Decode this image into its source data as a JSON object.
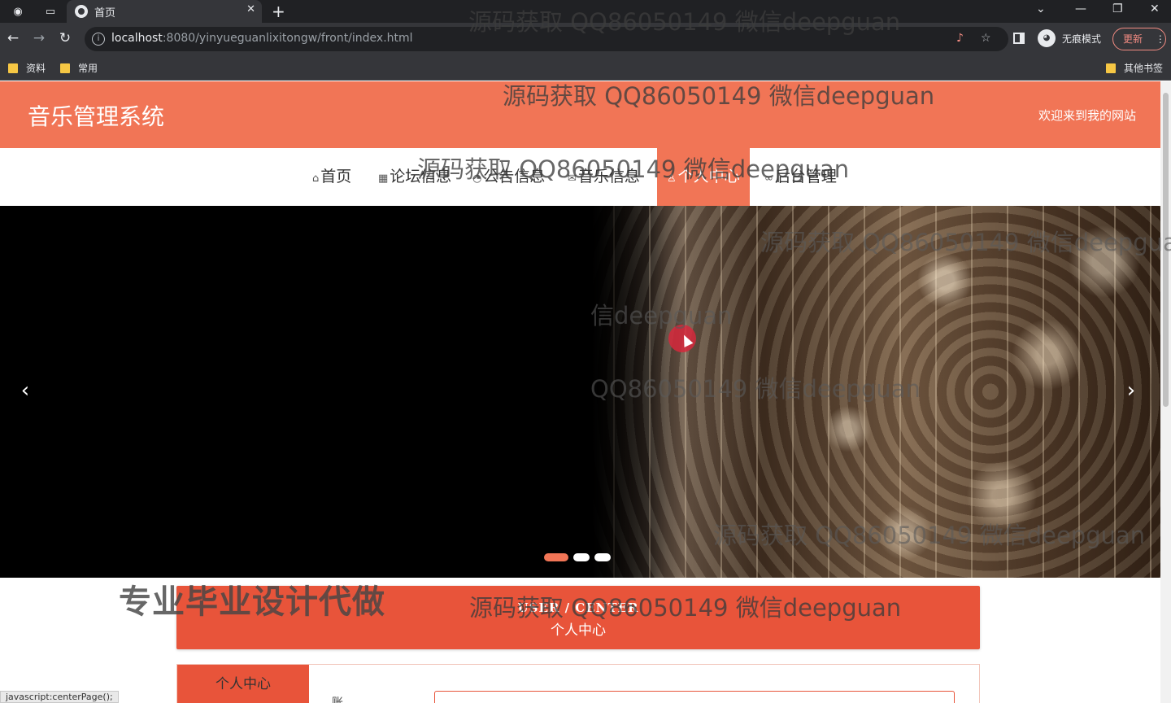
{
  "browser": {
    "tab_title": "首页",
    "tab_close": "✕",
    "new_tab": "+",
    "url_host": "localhost",
    "url_path": ":8080/yinyueguanlixitongw/front/index.html",
    "incognito_label": "无痕模式",
    "update_label": "更新",
    "bookmarks": [
      "资料",
      "常用"
    ],
    "other_bookmarks": "其他书签",
    "status_url": "javascript:centerPage();"
  },
  "site": {
    "title": "音乐管理系统",
    "welcome": "欢迎来到我的网站",
    "accent_color": "#f17556"
  },
  "nav": {
    "items": [
      {
        "label": "首页",
        "icon": "home-icon"
      },
      {
        "label": "论坛信息",
        "icon": "forum-icon"
      },
      {
        "label": "公告信息",
        "icon": "notice-icon"
      },
      {
        "label": "音乐信息",
        "icon": "mail-icon"
      },
      {
        "label": "个人中心",
        "icon": "user-icon"
      },
      {
        "label": "后台管理",
        "icon": "link-icon"
      }
    ],
    "active_index": 4
  },
  "carousel": {
    "slide_count": 3,
    "active_slide": 0
  },
  "section": {
    "title_en": "USER / CENTER",
    "title_cn": "个人中心"
  },
  "panel": {
    "tab_label": "个人中心",
    "field_label": "账"
  },
  "overlay": {
    "watermark_text": "源码获取 QQ86050149 微信deepguan",
    "watermark_partial_1": "信deepguan",
    "watermark_partial_2": "QQ86050149 微信deepguan",
    "promo_text": "专业毕业设计代做"
  }
}
